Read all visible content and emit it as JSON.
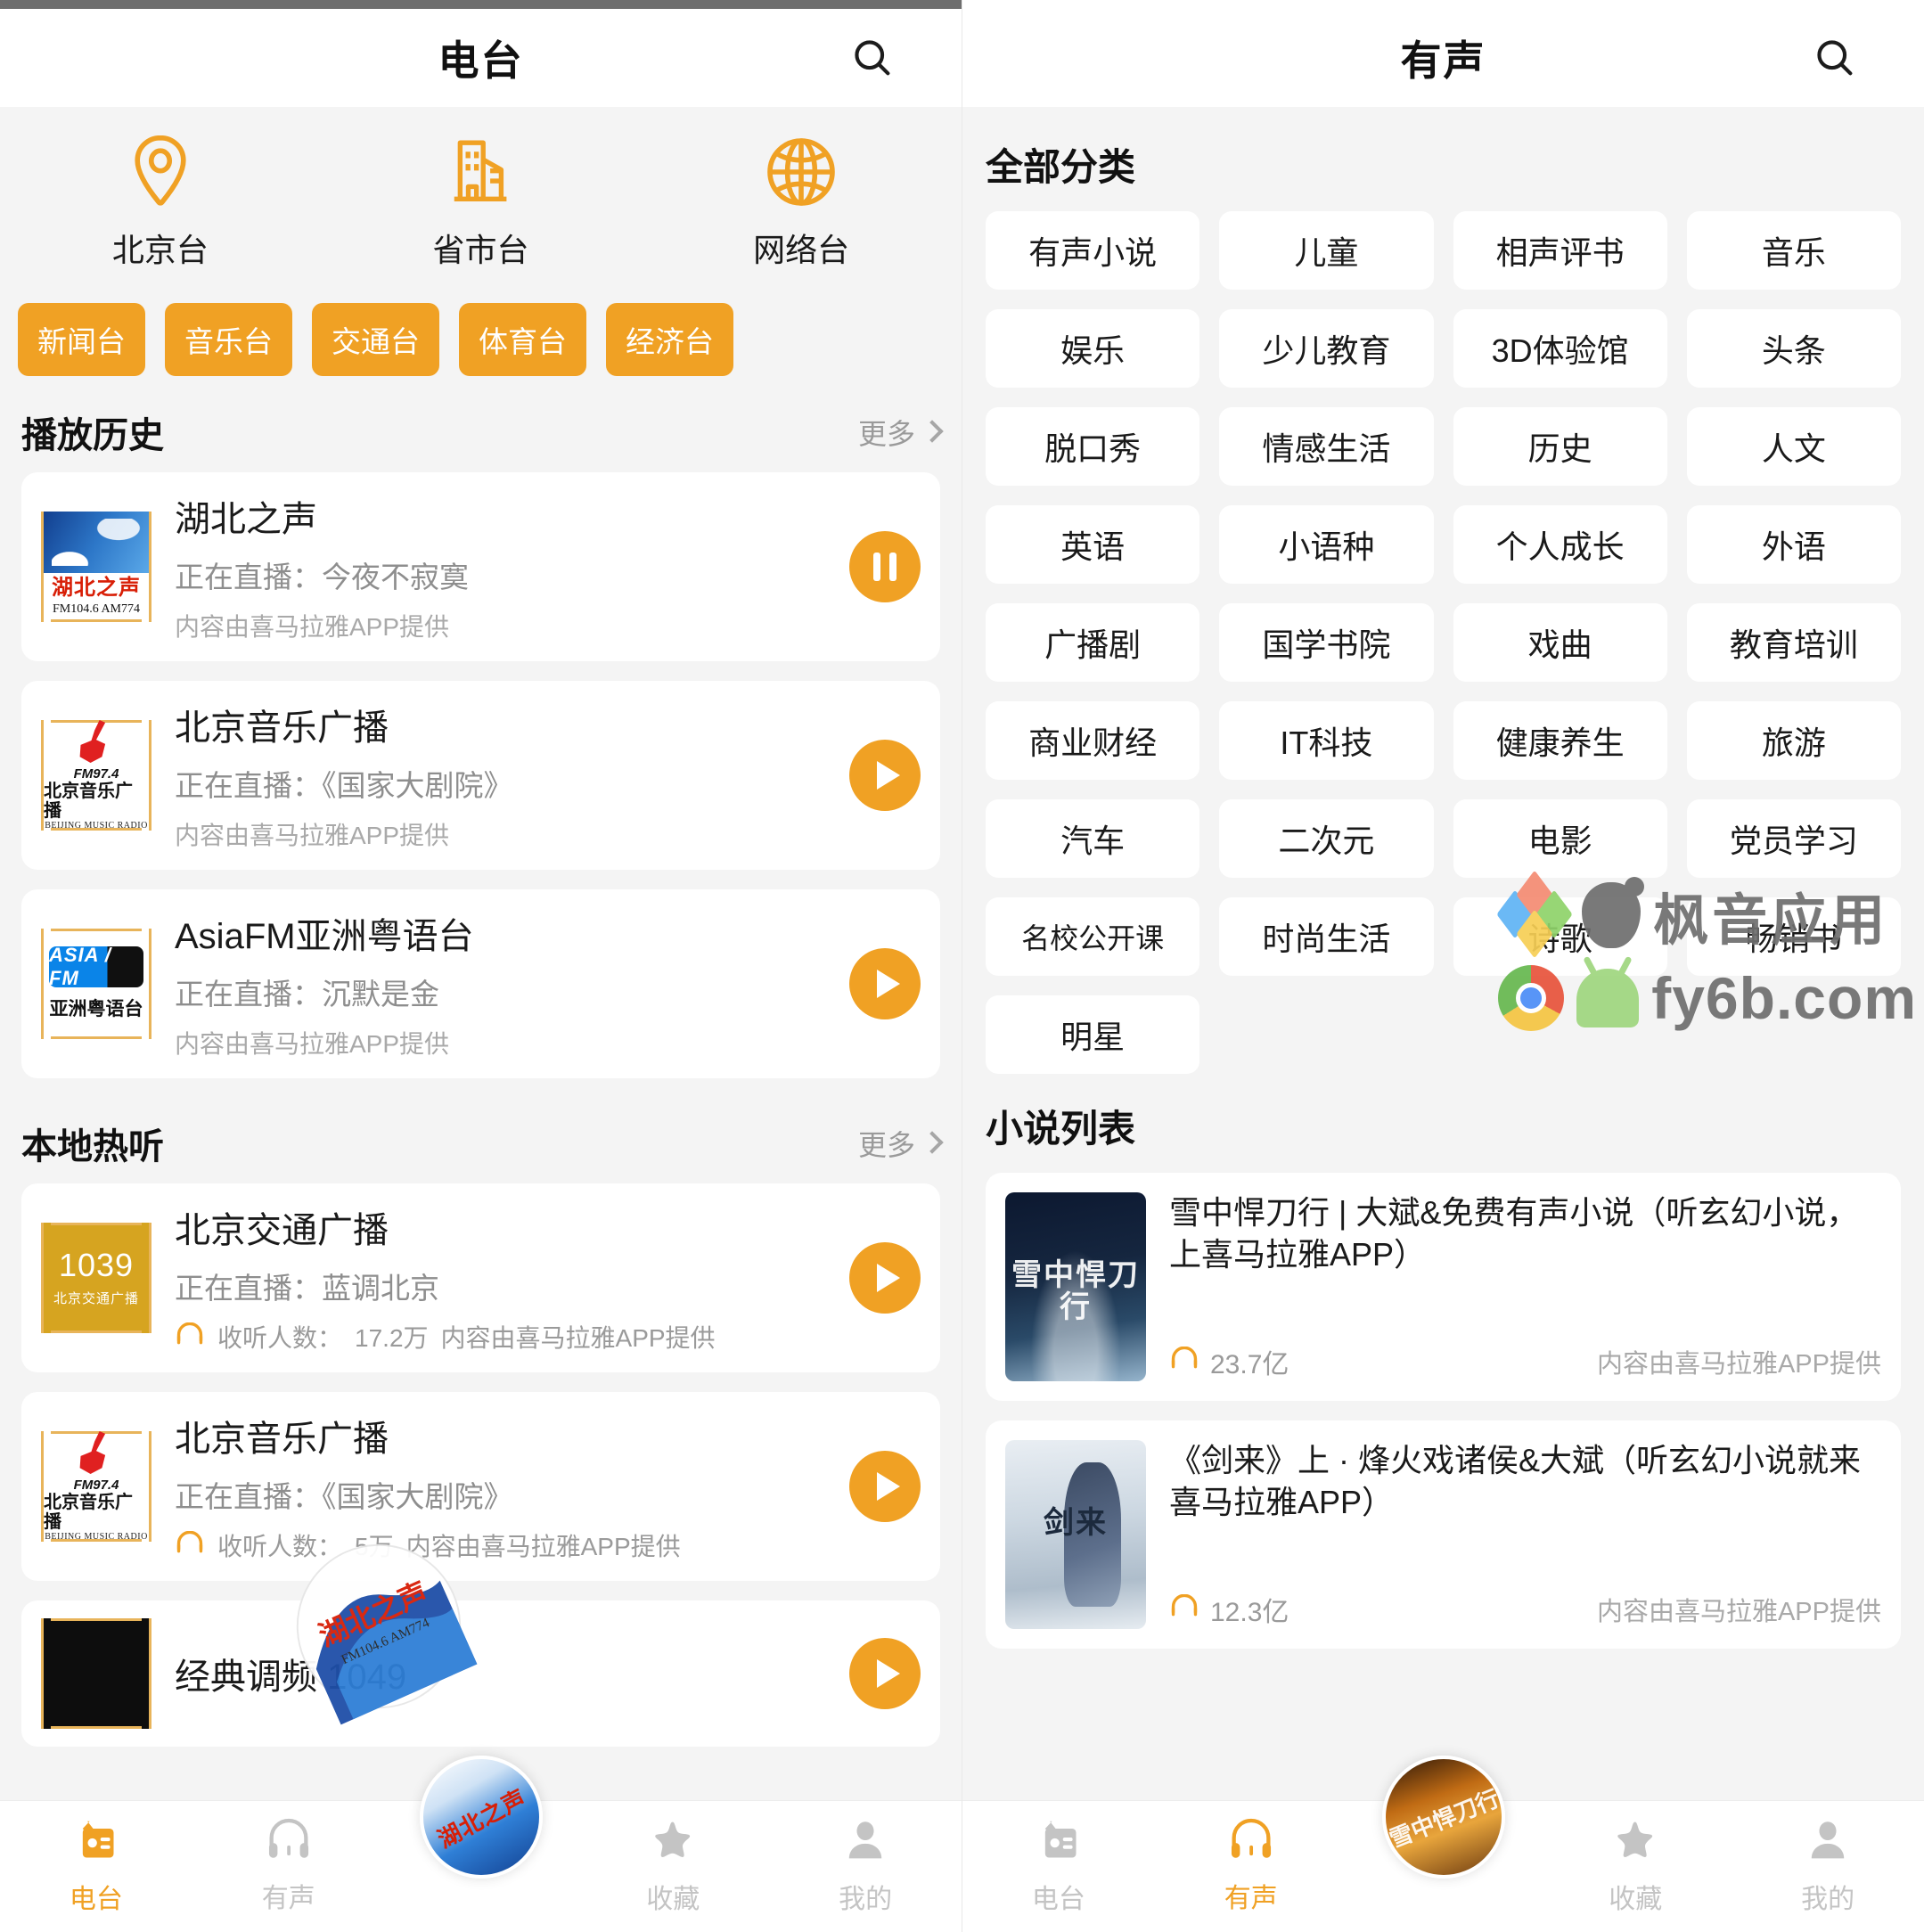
{
  "left_panel": {
    "header": {
      "title": "电台",
      "search_icon": "search-icon"
    },
    "quick_nav": [
      {
        "label": "北京台",
        "icon": "location-pin-icon"
      },
      {
        "label": "省市台",
        "icon": "building-icon"
      },
      {
        "label": "网络台",
        "icon": "globe-icon"
      }
    ],
    "chips": [
      "新闻台",
      "音乐台",
      "交通台",
      "体育台",
      "经济台"
    ],
    "history": {
      "title": "播放历史",
      "more_label": "更多",
      "items": [
        {
          "name": "湖北之声",
          "live": "正在直播：今夜不寂寞",
          "source": "内容由喜马拉雅APP提供",
          "state": "pause",
          "logo_cn": "湖北之声",
          "logo_fm": "FM104.6  AM774"
        },
        {
          "name": "北京音乐广播",
          "live": "正在直播：《国家大剧院》",
          "source": "内容由喜马拉雅APP提供",
          "state": "play",
          "logo_fm": "FM97.4",
          "logo_cn": "北京音乐广播",
          "logo_en": "BEIJING MUSIC RADIO"
        },
        {
          "name": "AsiaFM亚洲粤语台",
          "live": "正在直播：沉默是金",
          "source": "内容由喜马拉雅APP提供",
          "state": "play",
          "logo_badge": "ASIA / FM",
          "logo_cn": "亚洲粤语台"
        }
      ]
    },
    "local_hot": {
      "title": "本地热听",
      "more_label": "更多",
      "items": [
        {
          "name": "北京交通广播",
          "live": "正在直播：蓝调北京",
          "listeners_label": "收听人数：",
          "listeners": "17.2万",
          "source": "内容由喜马拉雅APP提供",
          "state": "play",
          "logo_num": "1039",
          "logo_cn": "北京交通广播"
        },
        {
          "name": "北京音乐广播",
          "live": "正在直播：《国家大剧院》",
          "listeners_label": "收听人数：",
          "listeners": "5万",
          "source": "内容由喜马拉雅APP提供",
          "state": "play",
          "logo_fm": "FM97.4",
          "logo_cn": "北京音乐广播",
          "logo_en": "BEIJING MUSIC RADIO"
        },
        {
          "name": "经典调频  1049",
          "live": "",
          "source": "",
          "state": "play"
        }
      ]
    },
    "tabbar": [
      {
        "label": "电台",
        "icon": "radio-icon",
        "active": true
      },
      {
        "label": "有声",
        "icon": "headphone-icon",
        "active": false
      },
      {
        "label": "",
        "icon": "now-playing-icon",
        "active": false
      },
      {
        "label": "收藏",
        "icon": "star-icon",
        "active": false
      },
      {
        "label": "我的",
        "icon": "person-icon",
        "active": false
      }
    ]
  },
  "right_panel": {
    "header": {
      "title": "有声",
      "search_icon": "search-icon"
    },
    "categories_title": "全部分类",
    "categories": [
      "有声小说",
      "儿童",
      "相声评书",
      "音乐",
      "娱乐",
      "少儿教育",
      "3D体验馆",
      "头条",
      "脱口秀",
      "情感生活",
      "历史",
      "人文",
      "英语",
      "小语种",
      "个人成长",
      "外语",
      "广播剧",
      "国学书院",
      "戏曲",
      "教育培训",
      "商业财经",
      "IT科技",
      "健康养生",
      "旅游",
      "汽车",
      "二次元",
      "电影",
      "党员学习",
      "名校公开课",
      "时尚生活",
      "诗歌",
      "畅销书",
      "明星"
    ],
    "novel_list_title": "小说列表",
    "novels": [
      {
        "title": "雪中悍刀行 | 大斌&免费有声小说（听玄幻小说，上喜马拉雅APP）",
        "plays": "23.7亿",
        "source": "内容由喜马拉雅APP提供",
        "cover_text": "雪中悍刀行"
      },
      {
        "title": "《剑来》上 · 烽火戏诸侯&大斌（听玄幻小说就来喜马拉雅APP）",
        "plays": "12.3亿",
        "source": "内容由喜马拉雅APP提供",
        "cover_text": "剑来"
      }
    ],
    "tabbar": [
      {
        "label": "电台",
        "icon": "radio-icon",
        "active": false
      },
      {
        "label": "有声",
        "icon": "headphone-icon",
        "active": true
      },
      {
        "label": "",
        "icon": "now-playing-icon",
        "active": false
      },
      {
        "label": "收藏",
        "icon": "star-icon",
        "active": false
      },
      {
        "label": "我的",
        "icon": "person-icon",
        "active": false
      }
    ]
  },
  "watermark": {
    "brand": "枫音应用",
    "site": "fy6b.com"
  },
  "colors": {
    "accent": "#f0a124",
    "page_bg": "#f4f4f4",
    "card_bg": "#ffffff",
    "text_primary": "#1a1a1a",
    "text_secondary": "#8e8e8e",
    "text_tertiary": "#a9a9a9",
    "tab_inactive": "#c4c4c4"
  }
}
